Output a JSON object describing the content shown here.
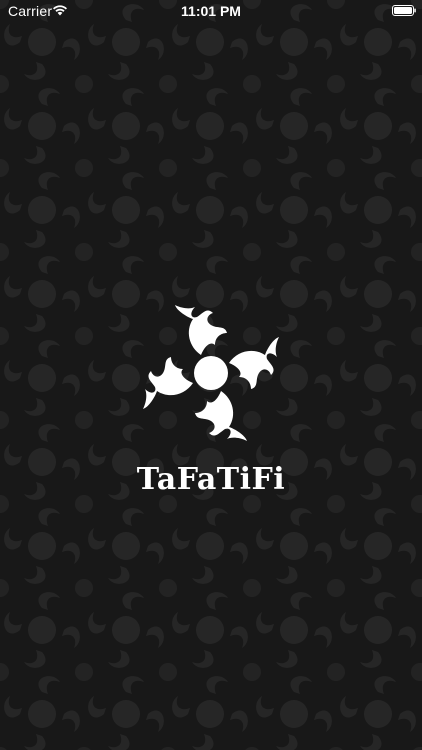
{
  "status_bar": {
    "carrier": "Carrier",
    "time": "11:01 PM",
    "wifi_icon": "wifi-icon",
    "battery_icon": "battery-icon"
  },
  "splash": {
    "logo_icon": "swirl-logo-icon",
    "app_name": "TaFaTiFi"
  },
  "colors": {
    "background": "#181818",
    "pattern": "#262626",
    "foreground": "#ffffff"
  }
}
